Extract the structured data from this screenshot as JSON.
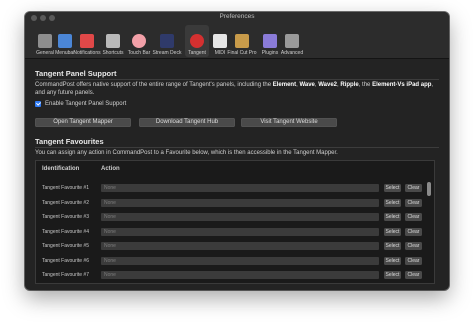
{
  "window": {
    "title": "Preferences"
  },
  "toolbar": {
    "items": [
      {
        "label": "General",
        "icon": "gear-panel-icon",
        "color": "#8e8e8e"
      },
      {
        "label": "Menubar",
        "icon": "menubar-icon",
        "color": "#4b86d6"
      },
      {
        "label": "Notifications",
        "icon": "notifications-icon",
        "color": "#e04848"
      },
      {
        "label": "Shortcuts",
        "icon": "keyboard-icon",
        "color": "#b9b9b9"
      },
      {
        "label": "Touch Bar",
        "icon": "touch-bar-icon",
        "color": "#f2a0a8"
      },
      {
        "label": "Stream Deck",
        "icon": "stream-deck-icon",
        "color": "#2f3a6a"
      },
      {
        "label": "Tangent",
        "icon": "tangent-icon",
        "color": "#d43030",
        "active": true
      },
      {
        "label": "MIDI",
        "icon": "midi-keyboard-icon",
        "color": "#e6e6e6"
      },
      {
        "label": "Final Cut Pro",
        "icon": "final-cut-pro-icon",
        "color": "#c89b4a"
      },
      {
        "label": "Plugins",
        "icon": "plugins-icon",
        "color": "#8a7bd8"
      },
      {
        "label": "Advanced",
        "icon": "advanced-gear-icon",
        "color": "#9a9a9a"
      }
    ]
  },
  "support": {
    "heading": "Tangent Panel Support",
    "desc_before": "CommandPost offers native support of the entire range of Tangent's panels, including the ",
    "b1": "Element",
    "sep1": ", ",
    "b2": "Wave",
    "sep2": ", ",
    "b3": "Wave2",
    "sep3": ", ",
    "b4": "Ripple",
    "sep4": ", the ",
    "b5": "Element-Vs iPad app",
    "desc_after": ", and any future panels.",
    "checkbox_label": "Enable Tangent Panel Support",
    "checkbox_checked": true,
    "buttons": {
      "open": "Open Tangent Mapper",
      "download": "Download Tangent Hub",
      "visit": "Visit Tangent Website"
    }
  },
  "favourites": {
    "heading": "Tangent Favourites",
    "desc": "You can assign any action in CommandPost to a Favourite below, which is then accessible in the Tangent Mapper.",
    "col_identification": "Identification",
    "col_action": "Action",
    "select_label": "Select",
    "clear_label": "Clear",
    "placeholder": "None",
    "rows": [
      {
        "id": "Tangent Favourite #1",
        "action": "None"
      },
      {
        "id": "Tangent Favourite #2",
        "action": "None"
      },
      {
        "id": "Tangent Favourite #3",
        "action": "None"
      },
      {
        "id": "Tangent Favourite #4",
        "action": "None"
      },
      {
        "id": "Tangent Favourite #5",
        "action": "None"
      },
      {
        "id": "Tangent Favourite #6",
        "action": "None"
      },
      {
        "id": "Tangent Favourite #7",
        "action": "None"
      }
    ]
  }
}
